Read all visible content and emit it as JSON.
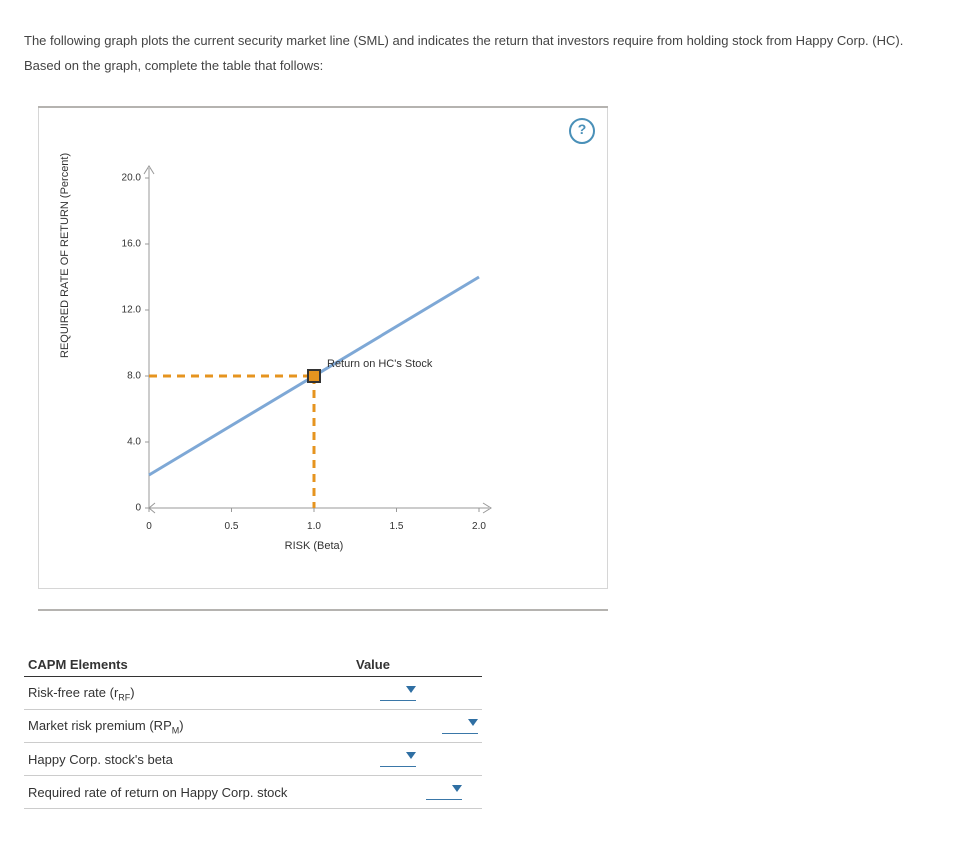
{
  "intro": "The following graph plots the current security market line (SML) and indicates the return that investors require from holding stock from Happy Corp. (HC). Based on the graph, complete the table that follows:",
  "help": "?",
  "chart_data": {
    "type": "line",
    "xlabel": "RISK (Beta)",
    "ylabel": "REQUIRED RATE OF RETURN (Percent)",
    "xlim": [
      0,
      2.0
    ],
    "ylim": [
      0,
      20.0
    ],
    "xticks": [
      "0",
      "0.5",
      "1.0",
      "1.5",
      "2.0"
    ],
    "yticks": [
      "0",
      "4.0",
      "8.0",
      "12.0",
      "16.0",
      "20.0"
    ],
    "series": [
      {
        "name": "SML",
        "x": [
          0,
          2.0
        ],
        "y": [
          2.0,
          14.0
        ],
        "color": "#7ea8d6"
      }
    ],
    "point": {
      "name": "Return on HC's Stock",
      "x": 1.0,
      "y": 8.0,
      "color": "#e6941f"
    }
  },
  "table": {
    "headers": {
      "col1": "CAPM Elements",
      "col2": "Value"
    },
    "rows": [
      {
        "label_pre": "Risk-free rate (r",
        "label_sub": "RF",
        "label_post": ")"
      },
      {
        "label_pre": "Market risk premium (RP",
        "label_sub": "M",
        "label_post": ")"
      },
      {
        "label_pre": "Happy Corp. stock's beta",
        "label_sub": "",
        "label_post": ""
      },
      {
        "label_pre": "Required rate of return on Happy Corp. stock",
        "label_sub": "",
        "label_post": ""
      }
    ]
  }
}
